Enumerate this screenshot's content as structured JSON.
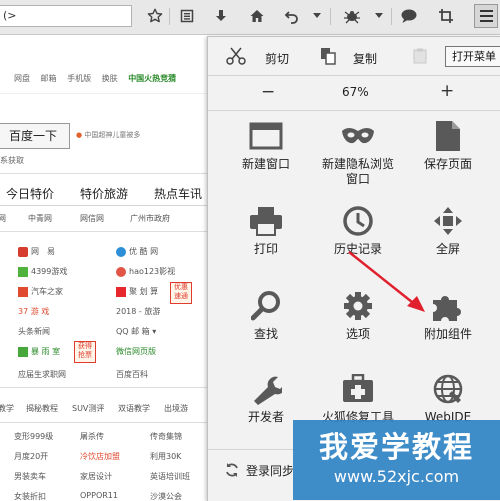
{
  "browser": {
    "url_text": "(>",
    "toolbar_icons": [
      "star-icon",
      "reading-list-icon",
      "download-icon",
      "home-icon",
      "back-icon",
      "dropdown-icon",
      "plugin-icon",
      "dropdown-icon",
      "chat-icon",
      "crop-icon",
      "menu-icon"
    ]
  },
  "page": {
    "top_links": [
      "网盘",
      "邮箱",
      "手机版",
      "换肤",
      "中国火热竞猜"
    ],
    "top_links_highlight": "中国火热竞猜",
    "search_button": "百度一下",
    "promo_text": "中国超神儿童被多",
    "below_search": "系获取",
    "tabs": [
      "今日特价",
      "特价旅游",
      "热点车讯"
    ],
    "cat_row": [
      "网",
      "中青网",
      "网信网",
      "广州市政府"
    ],
    "sites_left": [
      "网　易",
      "4399游戏",
      "汽车之家",
      "37 游 戏",
      "头条新闻",
      "暴 雨 室",
      "应届生求职网"
    ],
    "sites_right": [
      "优 酷 网",
      "hao123影视",
      "聚 划 算",
      "2018 - 旅游",
      "QQ 邮 箱",
      "微信网页版",
      "百度百科"
    ],
    "badges": [
      "优惠\n速通",
      "获得\n抢票"
    ],
    "sub_row": [
      "教学",
      "揭秘教程",
      "SUV测评",
      "双语教学",
      "出境游"
    ],
    "news_cols": [
      [
        "变形999级",
        "月度20开",
        "男装卖车",
        "女装折扣"
      ],
      [
        "屠杀传",
        "冷饮店加盟",
        "家居设计",
        "OPPOR11"
      ],
      [
        "传奇集锦",
        "利用30K",
        "英语培训班",
        "沙漠公会"
      ]
    ]
  },
  "menu": {
    "edit": {
      "cut": "剪切",
      "copy": "复制",
      "paste": ""
    },
    "zoom": {
      "minus": "−",
      "level": "67%",
      "plus": "+"
    },
    "items": [
      {
        "label": "新建窗口",
        "icon": "new-window-icon"
      },
      {
        "label": "新建隐私浏览\n窗口",
        "icon": "private-window-icon"
      },
      {
        "label": "保存页面",
        "icon": "save-page-icon"
      },
      {
        "label": "打印",
        "icon": "print-icon"
      },
      {
        "label": "历史记录",
        "icon": "history-icon"
      },
      {
        "label": "全屏",
        "icon": "fullscreen-icon"
      },
      {
        "label": "查找",
        "icon": "find-icon"
      },
      {
        "label": "选项",
        "icon": "options-icon"
      },
      {
        "label": "附加组件",
        "icon": "addons-icon"
      },
      {
        "label": "开发者",
        "icon": "developer-icon"
      },
      {
        "label": "火狐修复工具",
        "icon": "repair-tool-icon"
      },
      {
        "label": "WebIDE",
        "icon": "webide-icon"
      }
    ],
    "sign_in": "登录同步"
  },
  "tooltip": "打开菜单",
  "watermark": {
    "title": "我爱学教程",
    "url": "www.52xjc.com"
  },
  "colors": {
    "link_green": "#2a8a2a",
    "watermark_blue": "#2f83c4",
    "arrow_red": "#e0202d",
    "icon_dark": "#595959"
  }
}
